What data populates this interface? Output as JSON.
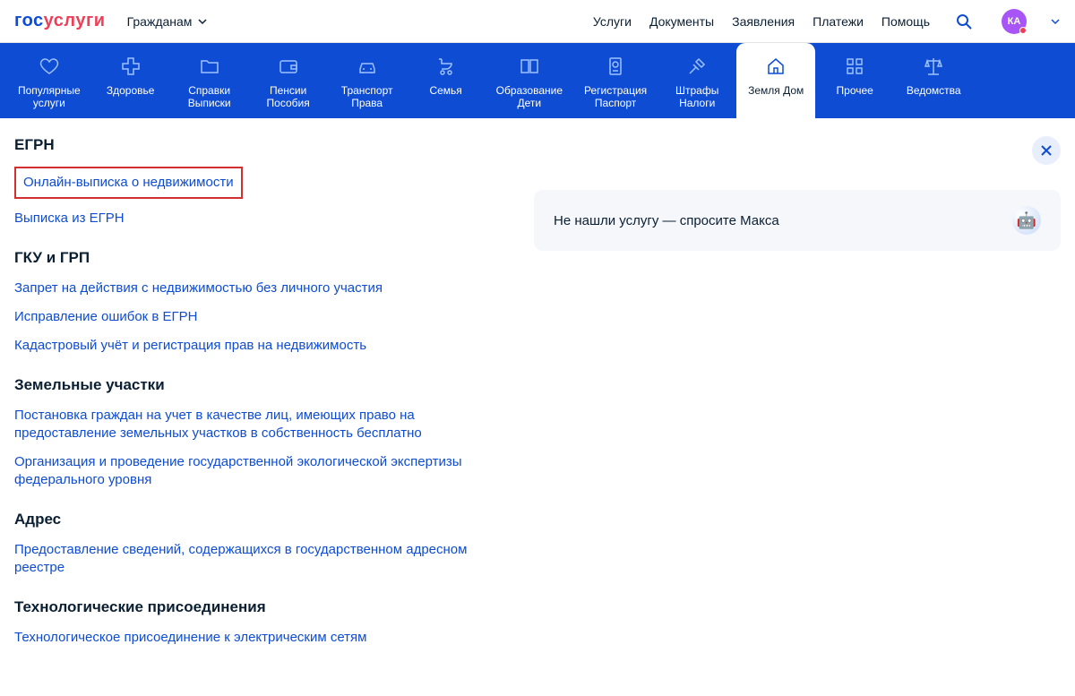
{
  "header": {
    "logo_gos": "гос",
    "logo_uslugi": "услуги",
    "audience": "Гражданам",
    "nav": [
      "Услуги",
      "Документы",
      "Заявления",
      "Платежи",
      "Помощь"
    ],
    "avatar_initials": "КА"
  },
  "tabs": [
    {
      "label": "Популярные\nуслуги",
      "icon": "heart"
    },
    {
      "label": "Здоровье",
      "icon": "medical"
    },
    {
      "label": "Справки\nВыписки",
      "icon": "folder"
    },
    {
      "label": "Пенсии\nПособия",
      "icon": "wallet"
    },
    {
      "label": "Транспорт\nПрава",
      "icon": "car"
    },
    {
      "label": "Семья",
      "icon": "stroller"
    },
    {
      "label": "Образование\nДети",
      "icon": "book"
    },
    {
      "label": "Регистрация\nПаспорт",
      "icon": "passport"
    },
    {
      "label": "Штрафы\nНалоги",
      "icon": "gavel"
    },
    {
      "label": "Земля Дом",
      "icon": "house",
      "active": true
    },
    {
      "label": "Прочее",
      "icon": "grid"
    },
    {
      "label": "Ведомства",
      "icon": "scales"
    }
  ],
  "sections": [
    {
      "title": "ЕГРН",
      "links": [
        {
          "text": "Онлайн-выписка о недвижимости",
          "highlighted": true
        },
        {
          "text": "Выписка из ЕГРН"
        }
      ]
    },
    {
      "title": "ГКУ и ГРП",
      "links": [
        {
          "text": "Запрет на действия с недвижимостью без личного участия"
        },
        {
          "text": "Исправление ошибок в ЕГРН"
        },
        {
          "text": "Кадастровый учёт и регистрация прав на недвижимость"
        }
      ]
    },
    {
      "title": "Земельные участки",
      "links": [
        {
          "text": "Постановка граждан на учет в качестве лиц, имеющих право на предоставление земельных участков в собственность бесплатно"
        },
        {
          "text": "Организация и проведение государственной экологической экспертизы федерального уровня"
        }
      ]
    },
    {
      "title": "Адрес",
      "links": [
        {
          "text": "Предоставление сведений, содержащихся в государственном адресном реестре"
        }
      ]
    },
    {
      "title": "Технологические присоединения",
      "links": [
        {
          "text": "Технологическое присоединение к электрическим сетям"
        }
      ]
    }
  ],
  "assistant": {
    "text": "Не нашли услугу — спросите Макса"
  }
}
